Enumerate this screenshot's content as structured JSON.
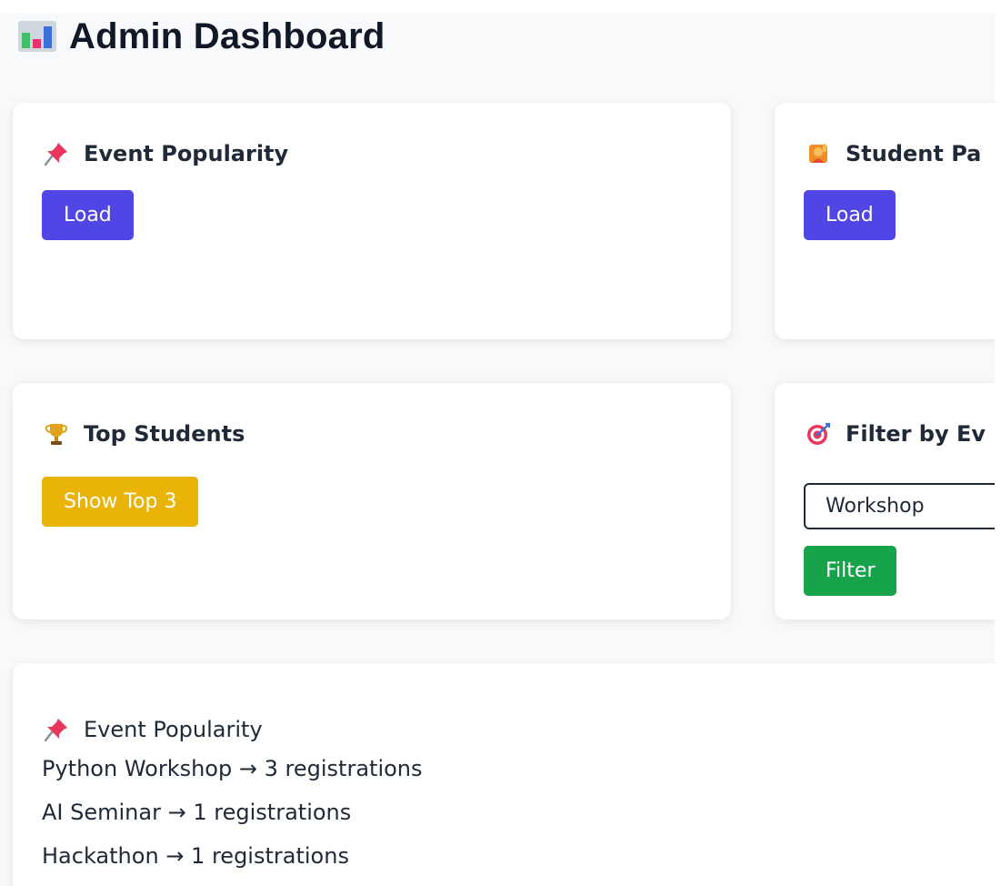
{
  "header": {
    "title": "Admin Dashboard",
    "icon": "bar-chart-icon"
  },
  "cards": {
    "event_popularity": {
      "icon": "pushpin-icon",
      "title": "Event Popularity",
      "button_label": "Load"
    },
    "student_participation": {
      "icon": "person-raising-hand-icon",
      "title": "Student Pa",
      "button_label": "Load"
    },
    "top_students": {
      "icon": "trophy-icon",
      "title": "Top Students",
      "button_label": "Show Top 3"
    },
    "filter_by_event": {
      "icon": "target-icon",
      "title": "Filter by Ev",
      "input_value": "Workshop",
      "button_label": "Filter"
    }
  },
  "results": {
    "icon": "pushpin-icon",
    "title": "Event Popularity",
    "rows": [
      {
        "event": "Python Workshop",
        "arrow": "→",
        "count": "3",
        "unit": "registrations"
      },
      {
        "event": "AI Seminar",
        "arrow": "→",
        "count": "1",
        "unit": "registrations"
      },
      {
        "event": "Hackathon",
        "arrow": "→",
        "count": "1",
        "unit": "registrations"
      }
    ]
  },
  "colors": {
    "primary": "#4f46e5",
    "warning": "#eab308",
    "success": "#16a34a",
    "background": "#f8f9fb",
    "card": "#ffffff"
  }
}
